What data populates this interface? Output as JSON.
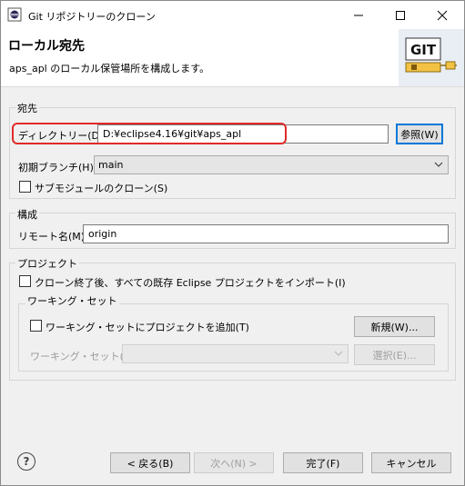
{
  "window": {
    "title": "Git リポジトリーのクローン",
    "minimize_icon": "minimize-icon",
    "maximize_icon": "maximize-icon",
    "close_icon": "close-icon"
  },
  "banner": {
    "title": "ローカル宛先",
    "description": "aps_apl のローカル保管場所を構成します。",
    "logo_text": "GIT"
  },
  "destination": {
    "group_label": "宛先",
    "directory_label": "ディレクトリー(D):",
    "directory_value": "D:¥eclipse4.16¥git¥aps_apl",
    "browse_button": "参照(W)",
    "initial_branch_label": "初期ブランチ(H):",
    "initial_branch_value": "main",
    "clone_submodules_label": "サブモジュールのクローン(S)",
    "clone_submodules_checked": false
  },
  "configuration": {
    "group_label": "構成",
    "remote_name_label": "リモート名(M):",
    "remote_name_value": "origin"
  },
  "projects": {
    "group_label": "プロジェクト",
    "import_label": "クローン終了後、すべての既存 Eclipse プロジェクトをインポート(I)",
    "import_checked": false,
    "working_set": {
      "group_label": "ワーキング・セット",
      "add_label": "ワーキング・セットにプロジェクトを追加(T)",
      "add_checked": false,
      "new_button": "新規(W)...",
      "sets_label": "ワーキング・セット(O):",
      "sets_value": "",
      "select_button": "選択(E)..."
    }
  },
  "footer": {
    "help_icon": "help-icon",
    "help_glyph": "?",
    "back_button": "< 戻る(B)",
    "next_button": "次へ(N) >",
    "finish_button": "完了(F)",
    "cancel_button": "キャンセル"
  },
  "colors": {
    "highlight": "#e02a2a",
    "focus": "#0078d7"
  }
}
